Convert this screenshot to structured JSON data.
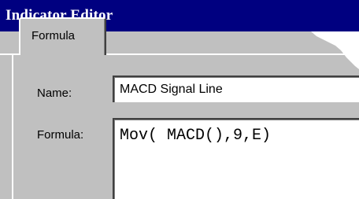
{
  "window": {
    "title": "Indicator Editor"
  },
  "tabs": [
    {
      "label": "Formula",
      "selected": true
    }
  ],
  "fields": {
    "name": {
      "label": "Name:",
      "value": "MACD Signal Line"
    },
    "formula": {
      "label": "Formula:",
      "value": "Mov( MACD(),9,E)"
    }
  },
  "colors": {
    "titlebar": "#000080",
    "face": "#c0c0c0",
    "highlight": "#ffffff",
    "shadow": "#808080"
  }
}
